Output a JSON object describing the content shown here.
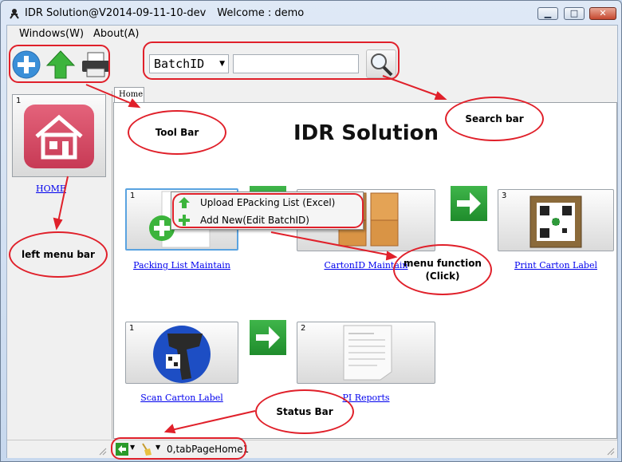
{
  "window": {
    "title": "IDR Solution@V2014-09-11-10-dev",
    "welcome": "Welcome : demo",
    "min_glyph": "▁",
    "max_glyph": "□",
    "close_glyph": "✕"
  },
  "menubar": {
    "items": [
      "Windows(W)",
      "About(A)"
    ]
  },
  "toolbar": {
    "icons": [
      "add-icon",
      "upload-arrow-icon",
      "printer-icon"
    ]
  },
  "search": {
    "field_value": "BatchID",
    "input_value": "",
    "button_icon": "magnifier-icon"
  },
  "left_menu": {
    "tile_number": "1",
    "icon": "house-icon",
    "link": "HOME"
  },
  "tabs": [
    {
      "label": "Home",
      "active": true
    }
  ],
  "main": {
    "title": "IDR Solution",
    "tiles": [
      {
        "number": "1",
        "label": "Packing List Maintain",
        "icon": "add-document-icon"
      },
      {
        "number": "2",
        "label": "CartonID Maintain",
        "icon": "cartons-icon"
      },
      {
        "number": "3",
        "label": "Print Carton Label",
        "icon": "qr-label-icon"
      },
      {
        "number": "1",
        "label": "Scan Carton Label",
        "icon": "barcode-scanner-icon"
      },
      {
        "number": "2",
        "label": "PI Reports",
        "icon": "report-document-icon"
      }
    ]
  },
  "context_menu": {
    "items": [
      {
        "label": "Upload EPacking List (Excel)",
        "icon": "upload-arrow-icon"
      },
      {
        "label": "Add New(Edit BatchID)",
        "icon": "add-icon"
      }
    ]
  },
  "statusbar": {
    "text": "0,tabPageHome1"
  },
  "annotations": {
    "tool_bar": "Tool Bar",
    "search_bar": "Search bar",
    "left_menu_bar": "left menu bar",
    "menu_function_line1": "menu function",
    "menu_function_line2": "(Click)",
    "status_bar": "Status Bar",
    "color": "#e0202a"
  },
  "colors": {
    "accent_green": "#2ea33a",
    "home_tile": "#d84a65",
    "link": "#0000ee"
  }
}
